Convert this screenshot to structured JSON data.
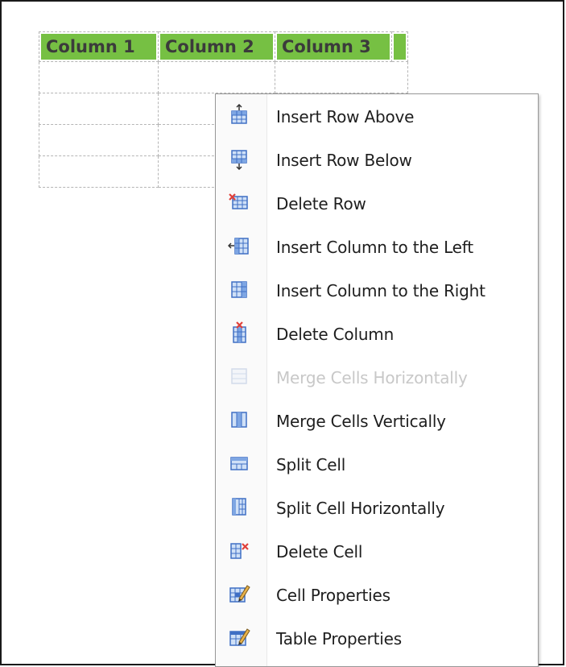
{
  "table": {
    "headers": [
      "Column 1",
      "Column 2",
      "Column 3",
      ""
    ],
    "rows": 4
  },
  "context_menu": {
    "items": [
      {
        "label": "Insert Row Above",
        "icon": "insert-row-above-icon",
        "enabled": true
      },
      {
        "label": "Insert Row Below",
        "icon": "insert-row-below-icon",
        "enabled": true
      },
      {
        "label": "Delete Row",
        "icon": "delete-row-icon",
        "enabled": true
      },
      {
        "label": "Insert Column to the Left",
        "icon": "insert-column-left-icon",
        "enabled": true
      },
      {
        "label": "Insert Column to the Right",
        "icon": "insert-column-right-icon",
        "enabled": true
      },
      {
        "label": "Delete Column",
        "icon": "delete-column-icon",
        "enabled": true
      },
      {
        "label": "Merge Cells Horizontally",
        "icon": "merge-cells-horizontally-icon",
        "enabled": false
      },
      {
        "label": "Merge Cells Vertically",
        "icon": "merge-cells-vertically-icon",
        "enabled": true
      },
      {
        "label": "Split Cell",
        "icon": "split-cell-icon",
        "enabled": true
      },
      {
        "label": "Split Cell Horizontally",
        "icon": "split-cell-horizontally-icon",
        "enabled": true
      },
      {
        "label": "Delete Cell",
        "icon": "delete-cell-icon",
        "enabled": true
      },
      {
        "label": "Cell Properties",
        "icon": "cell-properties-icon",
        "enabled": true
      },
      {
        "label": "Table Properties",
        "icon": "table-properties-icon",
        "enabled": true
      }
    ]
  },
  "colors": {
    "header_fill": "#76c043",
    "icon_blue": "#3f6fc4",
    "icon_red": "#e0403a",
    "disabled_text": "#c8c8c8"
  }
}
